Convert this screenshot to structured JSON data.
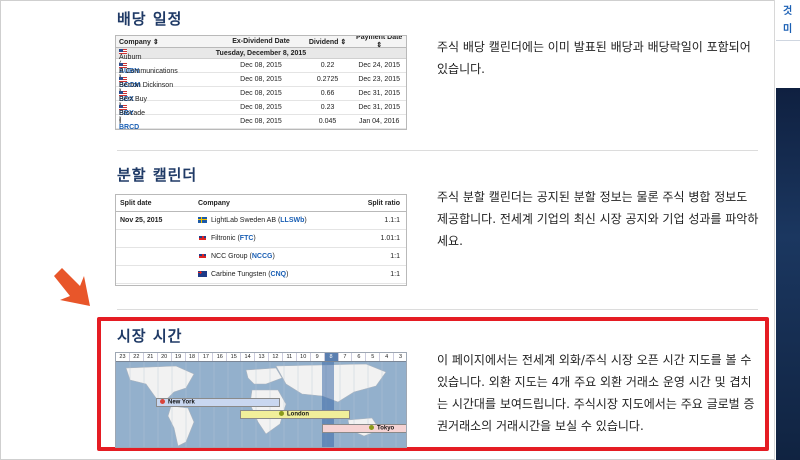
{
  "dividend": {
    "title": "배당 일정",
    "description": "주식 배당 캘린더에는 이미 발표된 배당과 배당락일이 포함되어 있습니다.",
    "headers": [
      "Company ⇕",
      "Ex-Dividend Date",
      "Dividend ⇕",
      "Payment Date ⇕"
    ],
    "date_group": "Tuesday, December 8, 2015",
    "rows": [
      {
        "name": "Auburn",
        "ticker": "AUBN",
        "ex_date": "Dec 08, 2015",
        "dividend": "0.22",
        "pay_date": "Dec 24, 2015"
      },
      {
        "name": "B Communications",
        "ticker": "BCOM",
        "ex_date": "Dec 08, 2015",
        "dividend": "0.2725",
        "pay_date": "Dec 23, 2015"
      },
      {
        "name": "Becton Dickinson",
        "ticker": "BDX",
        "ex_date": "Dec 08, 2015",
        "dividend": "0.66",
        "pay_date": "Dec 31, 2015"
      },
      {
        "name": "Best Buy",
        "ticker": "BBY",
        "ex_date": "Dec 08, 2015",
        "dividend": "0.23",
        "pay_date": "Dec 31, 2015"
      },
      {
        "name": "Brocade",
        "ticker": "BRCD",
        "ex_date": "Dec 08, 2015",
        "dividend": "0.045",
        "pay_date": "Jan 04, 2016"
      }
    ]
  },
  "split": {
    "title": "분할 캘린더",
    "description": "주식 분할 캘린더는 공지된 분할 정보는 물론 주식 병합 정보도 제공합니다. 전세계 기업의 최신 시장 공지와 기업 성과를 파악하세요.",
    "headers": [
      "Split date",
      "Company",
      "Split ratio"
    ],
    "date": "Nov 25, 2015",
    "rows": [
      {
        "name": "LightLab Sweden AB",
        "ticker": "LLSWb",
        "ratio": "1.1:1",
        "flag": "se"
      },
      {
        "name": "Filtronic",
        "ticker": "FTC",
        "ratio": "1.01:1",
        "flag": "gb"
      },
      {
        "name": "NCC Group",
        "ticker": "NCCG",
        "ratio": "1:1",
        "flag": "gb"
      },
      {
        "name": "Carbine Tungsten",
        "ticker": "CNQ",
        "ratio": "1:1",
        "flag": "au"
      }
    ]
  },
  "market_hours": {
    "title": "시장 시간",
    "description": "이 페이지에서는 전세계 외화/주식 시장 오픈 시간 지도를 볼 수 있습니다. 외환 지도는 4개 주요 외환 거래소 운영 시간 및 겹치는 시간대를 보여드립니다. 주식시장 지도에서는 주요 글로벌 증권거래소의 거래시간을 보실 수 있습니다.",
    "hours": [
      "23",
      "22",
      "21",
      "20",
      "19",
      "18",
      "17",
      "16",
      "15",
      "14",
      "13",
      "12",
      "11",
      "10",
      "9",
      "8",
      "7",
      "6",
      "5",
      "4",
      "3"
    ],
    "current_hour": "8",
    "markets": [
      {
        "name": "New York",
        "color": "#c9d7f0",
        "dot": "#d9443a"
      },
      {
        "name": "London",
        "color": "#f1ef9a",
        "dot": "#8a9a1a"
      },
      {
        "name": "Tokyo",
        "color": "#f6d3d3",
        "dot": "#8a9a1a"
      }
    ]
  },
  "right_panel": {
    "line1": "것",
    "line2": "미"
  },
  "colors": {
    "accent_red": "#e51c23",
    "arrow_orange": "#e8562a",
    "title_blue": "#1f3a66",
    "ticker_blue": "#1a5fb4"
  }
}
